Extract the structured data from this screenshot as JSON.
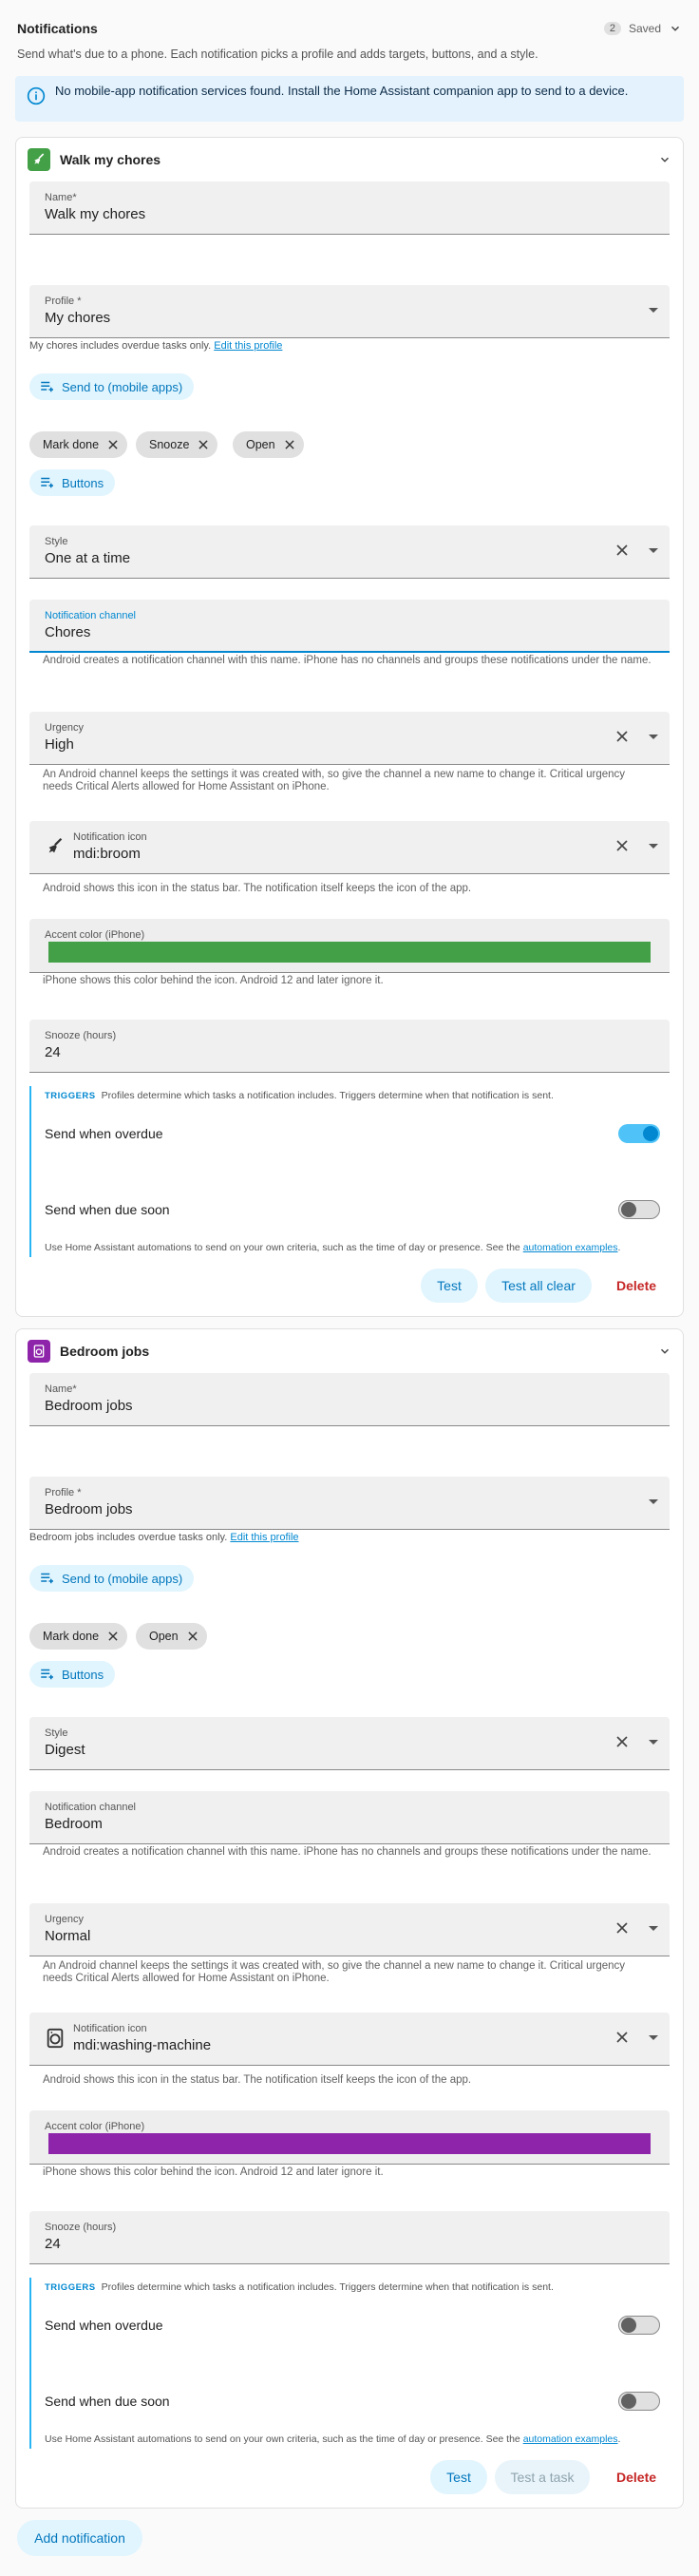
{
  "header": {
    "title": "Notifications",
    "count": "2",
    "status": "Saved",
    "subtitle": "Send what's due to a phone. Each notification picks a profile and adds targets, buttons, and a style."
  },
  "alert": {
    "text": "No mobile-app notification services found. Install the Home Assistant companion app to send to a device."
  },
  "cards": [
    {
      "title": "Walk my chores",
      "icon": "broom-icon",
      "icon_bg": "#43a047",
      "name_label": "Name*",
      "name_value": "Walk my chores",
      "profile_label": "Profile *",
      "profile_value": "My chores",
      "profile_helper": "My chores includes overdue tasks only.",
      "profile_link": "Edit this profile",
      "send_to_label": "Send to (mobile apps)",
      "chips": [
        "Mark done",
        "Snooze",
        "Open"
      ],
      "buttons_label": "Buttons",
      "style_label": "Style",
      "style_value": "One at a time",
      "channel_label": "Notification channel",
      "channel_value": "Chores",
      "channel_helper": "Android creates a notification channel with this name. iPhone has no channels and groups these notifications under the name.",
      "urgency_label": "Urgency",
      "urgency_value": "High",
      "urgency_helper": "An Android channel keeps the settings it was created with, so give the channel a new name to change it. Critical urgency needs Critical Alerts allowed for Home Assistant on iPhone.",
      "icon_field_label": "Notification icon",
      "icon_field_value": "mdi:broom",
      "icon_helper": "Android shows this icon in the status bar. The notification itself keeps the icon of the app.",
      "accent_label": "Accent color (iPhone)",
      "accent_color": "#43a047",
      "accent_helper": "iPhone shows this color behind the icon. Android 12 and later ignore it.",
      "snooze_label": "Snooze (hours)",
      "snooze_value": "24",
      "triggers_title": "TRIGGERS",
      "triggers_desc": "Profiles determine which tasks a notification includes. Triggers determine when that notification is sent.",
      "overdue_label": "Send when overdue",
      "overdue_on": true,
      "duesoon_label": "Send when due soon",
      "duesoon_on": false,
      "triggers_foot": "Use Home Assistant automations to send on your own criteria, such as the time of day or presence. See the",
      "triggers_link": "automation examples",
      "test_label": "Test",
      "test2_label": "Test all clear",
      "delete_label": "Delete"
    },
    {
      "title": "Bedroom jobs",
      "icon": "bin-icon",
      "icon_bg": "#8e24aa",
      "name_label": "Name*",
      "name_value": "Bedroom jobs",
      "profile_label": "Profile *",
      "profile_value": "Bedroom jobs",
      "profile_helper": "Bedroom jobs includes overdue tasks only.",
      "profile_link": "Edit this profile",
      "send_to_label": "Send to (mobile apps)",
      "chips": [
        "Mark done",
        "Open"
      ],
      "buttons_label": "Buttons",
      "style_label": "Style",
      "style_value": "Digest",
      "channel_label": "Notification channel",
      "channel_value": "Bedroom",
      "channel_helper": "Android creates a notification channel with this name. iPhone has no channels and groups these notifications under the name.",
      "urgency_label": "Urgency",
      "urgency_value": "Normal",
      "urgency_helper": "An Android channel keeps the settings it was created with, so give the channel a new name to change it. Critical urgency needs Critical Alerts allowed for Home Assistant on iPhone.",
      "icon_field_label": "Notification icon",
      "icon_field_value": "mdi:washing-machine",
      "icon_helper": "Android shows this icon in the status bar. The notification itself keeps the icon of the app.",
      "accent_label": "Accent color (iPhone)",
      "accent_color": "#8e24aa",
      "accent_helper": "iPhone shows this color behind the icon. Android 12 and later ignore it.",
      "snooze_label": "Snooze (hours)",
      "snooze_value": "24",
      "triggers_title": "TRIGGERS",
      "triggers_desc": "Profiles determine which tasks a notification includes. Triggers determine when that notification is sent.",
      "overdue_label": "Send when overdue",
      "overdue_on": false,
      "duesoon_label": "Send when due soon",
      "duesoon_on": false,
      "triggers_foot": "Use Home Assistant automations to send on your own criteria, such as the time of day or presence. See the",
      "triggers_link": "automation examples",
      "test_label": "Test",
      "test2_label": "Test a task",
      "delete_label": "Delete"
    }
  ],
  "add_notification_label": "Add notification"
}
